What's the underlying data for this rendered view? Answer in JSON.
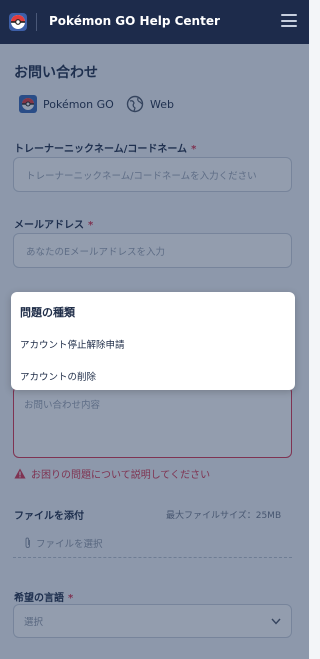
{
  "header": {
    "title": "Pokémon GO Help Center",
    "logo_icon": "pokeball-icon",
    "menu_icon": "hamburger-menu-icon"
  },
  "page": {
    "title": "お問い合わせ"
  },
  "platforms": [
    {
      "label": "Pokémon GO",
      "icon": "pokemon-go-app-icon"
    },
    {
      "label": "Web",
      "icon": "globe-icon"
    }
  ],
  "fields": {
    "trainer_name": {
      "label": "トレーナーニックネーム/コードネーム",
      "required": "*",
      "placeholder": "トレーナーニックネーム/コードネームを入力ください"
    },
    "email": {
      "label": "メールアドレス",
      "required": "*",
      "placeholder": "あなたのEメールアドレスを入力"
    },
    "message": {
      "placeholder": "お問い合わせ内容",
      "error": "お困りの問題について説明してください"
    },
    "attachment": {
      "label": "ファイルを添付",
      "max_size": "最大ファイルサイズ：25MB",
      "button": "ファイルを選択"
    },
    "language": {
      "label": "希望の言語",
      "required": "*",
      "value": "選択"
    }
  },
  "issue_popup": {
    "title": "問題の種類",
    "options": [
      "アカウント停止解除申請",
      "アカウントの削除"
    ]
  },
  "colors": {
    "header_bg": "#1d2b4b",
    "error": "#d8354f",
    "overlay": "rgba(30,50,85,0.48)"
  }
}
